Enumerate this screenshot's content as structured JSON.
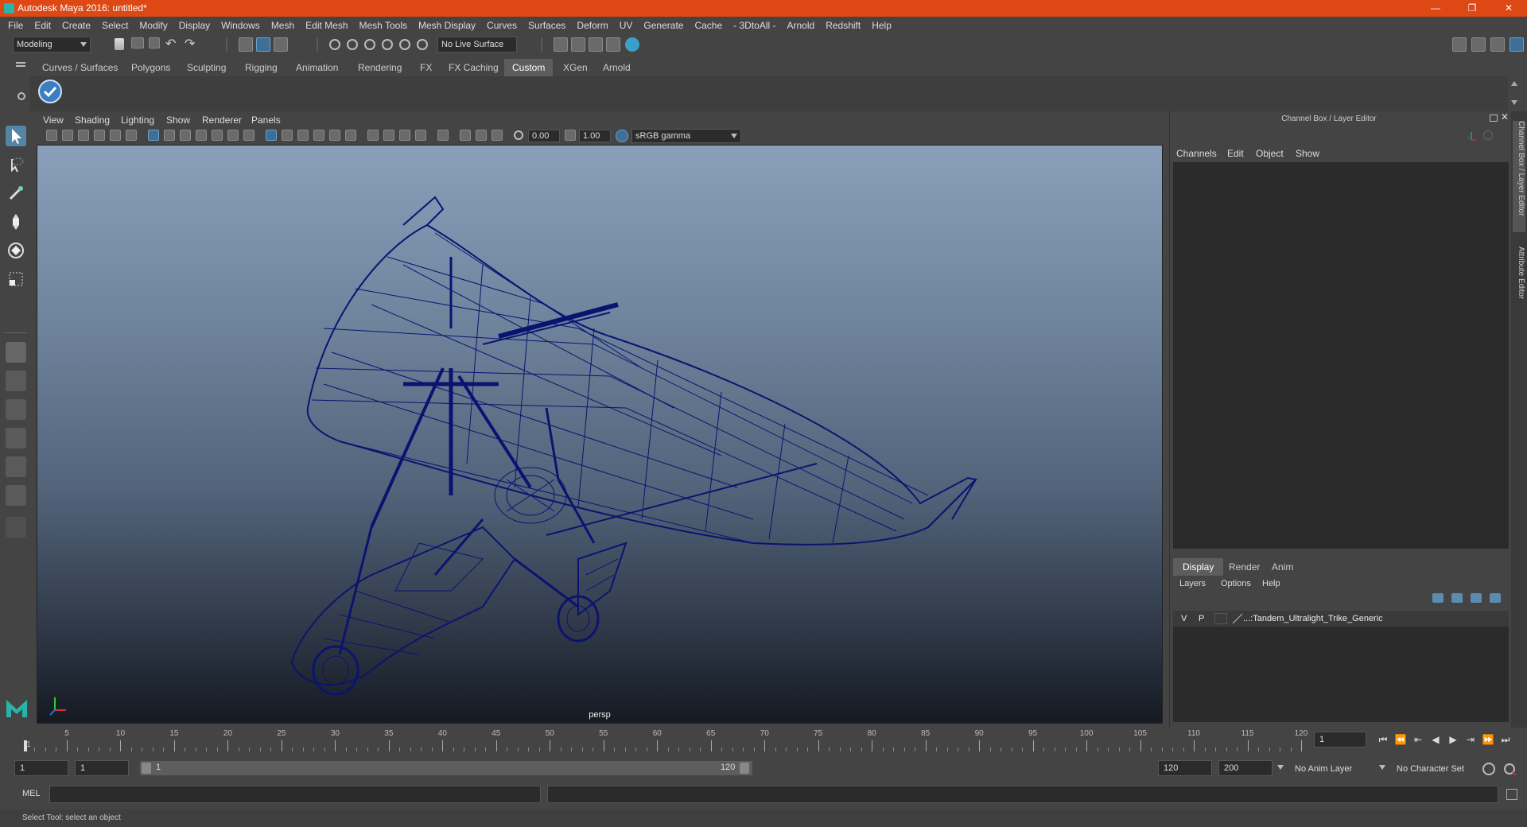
{
  "window": {
    "title": "Autodesk Maya 2016: untitled*",
    "minimize": "—",
    "maximize": "❐",
    "close": "✕"
  },
  "menubar": {
    "items": [
      "File",
      "Edit",
      "Create",
      "Select",
      "Modify",
      "Display",
      "Windows",
      "Mesh",
      "Edit Mesh",
      "Mesh Tools",
      "Mesh Display",
      "Curves",
      "Surfaces",
      "Deform",
      "UV",
      "Generate",
      "Cache",
      "- 3DtoAll -",
      "Arnold",
      "Redshift",
      "Help"
    ]
  },
  "statusline": {
    "mode": "Modeling",
    "live_surface": "No Live Surface"
  },
  "shelf": {
    "tabs": [
      "Curves / Surfaces",
      "Polygons",
      "Sculpting",
      "Rigging",
      "Animation",
      "Rendering",
      "FX",
      "FX Caching",
      "Custom",
      "XGen",
      "Arnold"
    ],
    "active_tab": "Custom"
  },
  "viewport": {
    "menus": [
      "View",
      "Shading",
      "Lighting",
      "Show",
      "Renderer",
      "Panels"
    ],
    "exposure": "0.00",
    "gamma": "1.00",
    "color_space": "sRGB gamma",
    "camera": "persp"
  },
  "channel_box": {
    "title": "Channel Box / Layer Editor",
    "menus": [
      "Channels",
      "Edit",
      "Object",
      "Show"
    ],
    "layer_tabs": [
      "Display",
      "Render",
      "Anim"
    ],
    "active_layer_tab": "Display",
    "layer_menus": [
      "Layers",
      "Options",
      "Help"
    ],
    "layer": {
      "visible": "V",
      "playback": "P",
      "name": "...:Tandem_Ultralight_Trike_Generic"
    }
  },
  "side_tabs": {
    "channel_box": "Channel Box / Layer Editor",
    "attribute_editor": "Attribute Editor"
  },
  "timeline": {
    "ticks": [
      1,
      5,
      10,
      15,
      20,
      25,
      30,
      35,
      40,
      45,
      50,
      55,
      60,
      65,
      70,
      75,
      80,
      85,
      90,
      95,
      100,
      105,
      110,
      115,
      120
    ],
    "start": 1,
    "end": 120,
    "current_frame": "1"
  },
  "range": {
    "start_time": "1",
    "playback_start": "1",
    "slider_start": "1",
    "slider_end": "120",
    "playback_end": "120",
    "end_time": "200",
    "anim_layer": "No Anim Layer",
    "character_set": "No Character Set"
  },
  "command_line": {
    "language": "MEL"
  },
  "help_line": {
    "text": "Select Tool: select an object"
  },
  "colors": {
    "title_bar": "#dd4814",
    "accent": "#5285a6",
    "wireframe": "#0a1470",
    "panel": "#444444"
  }
}
